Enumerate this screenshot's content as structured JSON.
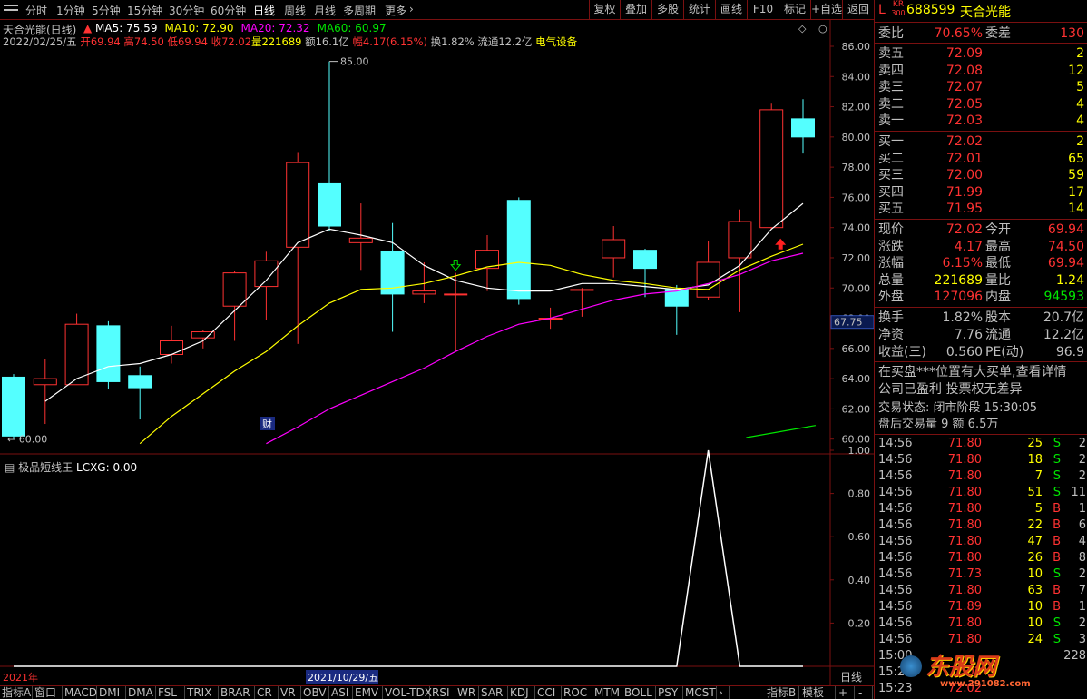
{
  "topbar": {
    "tabs": [
      "分时",
      "1分钟",
      "5分钟",
      "15分钟",
      "30分钟",
      "60分钟",
      "日线",
      "周线",
      "月线",
      "多周期",
      "更多"
    ],
    "active": "日线",
    "more_arrow": "›",
    "buttons": [
      "复权",
      "叠加",
      "多股",
      "统计",
      "画线",
      "F10",
      "标记",
      "+自选",
      "返回"
    ]
  },
  "chart": {
    "title": "天合光能(日线)",
    "ma": [
      {
        "label": "MA5: 75.59",
        "color": "#ffffff"
      },
      {
        "label": "MA10: 72.90",
        "color": "#ffff00"
      },
      {
        "label": "MA20: 72.32",
        "color": "#ff00ff"
      },
      {
        "label": "MA60: 60.97",
        "color": "#00e600"
      }
    ],
    "ohlc_line": {
      "date": "2022/02/25/五",
      "open": "开69.94",
      "high": "高74.50",
      "low": "低69.94",
      "close": "收72.02",
      "volume": "量221689",
      "amount": "额16.1亿",
      "change": "幅4.17(6.15%)",
      "turnover": "换1.82%",
      "float": "流通12.2亿",
      "sector": "电气设备"
    },
    "high_marker": "85.00",
    "low_marker": "60.00",
    "price_label": "67.75",
    "cai_badge": "财",
    "y_ticks": [
      "86.00",
      "84.00",
      "82.00",
      "80.00",
      "78.00",
      "76.00",
      "74.00",
      "72.00",
      "70.00",
      "68.00",
      "66.00",
      "64.00",
      "62.00",
      "60.00"
    ],
    "date_left": "2021年",
    "date_mid": "2021/10/29/五",
    "period_label": "日线"
  },
  "indicator": {
    "title": "极品短线王",
    "value": "LCXG: 0.00",
    "y_ticks": [
      "1.00",
      "0.80",
      "0.60",
      "0.40",
      "0.20"
    ]
  },
  "chart_data": {
    "type": "candlestick",
    "ylim": [
      59.5,
      86.6
    ],
    "candles": [
      {
        "o": 64.1,
        "h": 64.3,
        "l": 60.0,
        "c": 60.2
      },
      {
        "o": 63.6,
        "h": 65.3,
        "l": 61.0,
        "c": 64.0
      },
      {
        "o": 63.6,
        "h": 68.3,
        "l": 63.6,
        "c": 67.6
      },
      {
        "o": 67.5,
        "h": 67.8,
        "l": 63.3,
        "c": 63.8
      },
      {
        "o": 64.2,
        "h": 64.8,
        "l": 61.3,
        "c": 63.4
      },
      {
        "o": 65.6,
        "h": 67.5,
        "l": 65.0,
        "c": 66.5
      },
      {
        "o": 66.7,
        "h": 67.2,
        "l": 66.0,
        "c": 67.1
      },
      {
        "o": 68.8,
        "h": 71.1,
        "l": 66.5,
        "c": 71.0
      },
      {
        "o": 70.1,
        "h": 72.4,
        "l": 67.9,
        "c": 71.8
      },
      {
        "o": 72.7,
        "h": 79.0,
        "l": 66.3,
        "c": 78.3
      },
      {
        "o": 76.9,
        "h": 85.0,
        "l": 73.8,
        "c": 74.1
      },
      {
        "o": 73.0,
        "h": 75.6,
        "l": 71.2,
        "c": 73.3
      },
      {
        "o": 72.4,
        "h": 74.3,
        "l": 67.1,
        "c": 69.6
      },
      {
        "o": 69.6,
        "h": 71.7,
        "l": 69.0,
        "c": 69.8
      },
      {
        "o": 69.6,
        "h": 71.0,
        "l": 65.8,
        "c": 69.6
      },
      {
        "o": 71.3,
        "h": 73.5,
        "l": 69.8,
        "c": 72.5
      },
      {
        "o": 75.8,
        "h": 76.0,
        "l": 68.9,
        "c": 69.3
      },
      {
        "o": 68.0,
        "h": 68.7,
        "l": 67.3,
        "c": 68.0
      },
      {
        "o": 69.9,
        "h": 70.0,
        "l": 68.1,
        "c": 69.9
      },
      {
        "o": 72.0,
        "h": 74.1,
        "l": 70.7,
        "c": 73.2
      },
      {
        "o": 72.5,
        "h": 72.6,
        "l": 69.4,
        "c": 71.3
      },
      {
        "o": 69.9,
        "h": 70.2,
        "l": 66.9,
        "c": 68.8
      },
      {
        "o": 69.4,
        "h": 73.1,
        "l": 69.2,
        "c": 71.7
      },
      {
        "o": 72.0,
        "h": 75.2,
        "l": 68.4,
        "c": 74.4
      },
      {
        "o": 74.0,
        "h": 82.2,
        "l": 73.9,
        "c": 81.8
      },
      {
        "o": 81.2,
        "h": 82.5,
        "l": 78.9,
        "c": 80.0
      }
    ],
    "ma5": [
      null,
      62.5,
      64.0,
      64.8,
      65.0,
      65.6,
      66.5,
      68.5,
      70.5,
      73.0,
      73.9,
      73.5,
      73.0,
      71.5,
      70.5,
      70.0,
      69.8,
      69.8,
      70.3,
      70.3,
      70.1,
      69.9,
      70.2,
      71.5,
      73.9,
      75.6
    ],
    "ma10": [
      null,
      null,
      null,
      null,
      59.7,
      61.5,
      63.0,
      64.5,
      65.8,
      67.5,
      69.0,
      69.9,
      70.0,
      70.3,
      70.8,
      71.4,
      71.7,
      71.5,
      70.9,
      70.5,
      70.3,
      70.0,
      69.9,
      71.2,
      72.1,
      72.9
    ],
    "ma20": [
      null,
      null,
      null,
      null,
      null,
      null,
      null,
      null,
      59.7,
      60.8,
      62.0,
      62.9,
      63.8,
      64.7,
      65.8,
      66.8,
      67.6,
      68.0,
      68.6,
      69.2,
      69.6,
      69.8,
      70.3,
      70.9,
      71.8,
      72.3
    ],
    "ma60": [
      {
        "x": 23.2,
        "y": 60.1
      },
      {
        "x": 25.4,
        "y": 60.9
      }
    ],
    "lcxg": [
      0,
      0,
      0,
      0,
      0,
      0,
      0,
      0,
      0,
      0,
      0,
      0,
      0,
      0,
      0,
      0,
      0,
      0,
      0,
      0,
      0,
      0,
      1,
      0,
      0,
      0
    ],
    "up_arrow_index": 24,
    "down_arrow_index": 14
  },
  "quote": {
    "market_badge": "L",
    "kr_badge": "KR",
    "kr_sub": "300",
    "code": "688599",
    "name": "天合光能",
    "weibi_label": "委比",
    "weibi": "70.65%",
    "weicha_label": "委差",
    "weicha": "130",
    "asks": [
      {
        "label": "卖五",
        "price": "72.09",
        "vol": "2"
      },
      {
        "label": "卖四",
        "price": "72.08",
        "vol": "12"
      },
      {
        "label": "卖三",
        "price": "72.07",
        "vol": "5"
      },
      {
        "label": "卖二",
        "price": "72.05",
        "vol": "4"
      },
      {
        "label": "卖一",
        "price": "72.03",
        "vol": "4"
      }
    ],
    "bids": [
      {
        "label": "买一",
        "price": "72.02",
        "vol": "2"
      },
      {
        "label": "买二",
        "price": "72.01",
        "vol": "65"
      },
      {
        "label": "买三",
        "price": "72.00",
        "vol": "59"
      },
      {
        "label": "买四",
        "price": "71.99",
        "vol": "17"
      },
      {
        "label": "买五",
        "price": "71.95",
        "vol": "14"
      }
    ],
    "stats": [
      {
        "l1": "现价",
        "v1": "72.02",
        "c1": "#ff3232",
        "l2": "今开",
        "v2": "69.94",
        "c2": "#ff3232"
      },
      {
        "l1": "涨跌",
        "v1": "4.17",
        "c1": "#ff3232",
        "l2": "最高",
        "v2": "74.50",
        "c2": "#ff3232"
      },
      {
        "l1": "涨幅",
        "v1": "6.15%",
        "c1": "#ff3232",
        "l2": "最低",
        "v2": "69.94",
        "c2": "#ff3232"
      },
      {
        "l1": "总量",
        "v1": "221689",
        "c1": "#ffff00",
        "l2": "量比",
        "v2": "1.24",
        "c2": "#ffff00"
      },
      {
        "l1": "外盘",
        "v1": "127096",
        "c1": "#ff3232",
        "l2": "内盘",
        "v2": "94593",
        "c2": "#00e600"
      }
    ],
    "fin": [
      {
        "l1": "换手",
        "v1": "1.82%",
        "l2": "股本",
        "v2": "20.7亿"
      },
      {
        "l1": "净资",
        "v1": "7.76",
        "l2": "流通",
        "v2": "12.2亿"
      },
      {
        "l1": "收益(三)",
        "v1": "0.560",
        "l2": "PE(动)",
        "v2": "96.9"
      }
    ],
    "notes": [
      "在买盘***位置有大买单,查看详情",
      "公司已盈利 投票权无差异"
    ],
    "trade_status": "交易状态: 闭市阶段 15:30:05",
    "after_hours": "盘后交易量 9 额 6.5万"
  },
  "ticks": [
    {
      "t": "14:56",
      "p": "71.80",
      "v": "25",
      "s": "S",
      "n": "2"
    },
    {
      "t": "14:56",
      "p": "71.80",
      "v": "18",
      "s": "S",
      "n": "2"
    },
    {
      "t": "14:56",
      "p": "71.80",
      "v": "7",
      "s": "S",
      "n": "2"
    },
    {
      "t": "14:56",
      "p": "71.80",
      "v": "51",
      "s": "S",
      "n": "11"
    },
    {
      "t": "14:56",
      "p": "71.80",
      "v": "5",
      "s": "B",
      "n": "1"
    },
    {
      "t": "14:56",
      "p": "71.80",
      "v": "22",
      "s": "B",
      "n": "6"
    },
    {
      "t": "14:56",
      "p": "71.80",
      "v": "47",
      "s": "B",
      "n": "4"
    },
    {
      "t": "14:56",
      "p": "71.80",
      "v": "26",
      "s": "B",
      "n": "8"
    },
    {
      "t": "14:56",
      "p": "71.73",
      "v": "10",
      "s": "S",
      "n": "2"
    },
    {
      "t": "14:56",
      "p": "71.80",
      "v": "63",
      "s": "B",
      "n": "7"
    },
    {
      "t": "14:56",
      "p": "71.89",
      "v": "10",
      "s": "B",
      "n": "1"
    },
    {
      "t": "14:56",
      "p": "71.80",
      "v": "10",
      "s": "S",
      "n": "2"
    },
    {
      "t": "14:56",
      "p": "71.80",
      "v": "24",
      "s": "S",
      "n": "3"
    },
    {
      "t": "15:00",
      "p": "",
      "v": "",
      "s": "",
      "n": "228"
    },
    {
      "t": "15:23",
      "p": "72.02",
      "v": "",
      "s": "",
      "n": ""
    },
    {
      "t": "15:23",
      "p": "72.02",
      "v": "",
      "s": "",
      "n": ""
    }
  ],
  "bottom_tabs": [
    "指标A",
    "窗口",
    "MACD",
    "DMI",
    "DMA",
    "FSL",
    "TRIX",
    "BRAR",
    "CR",
    "VR",
    "OBV",
    "ASI",
    "EMV",
    "VOL-TDX",
    "RSI",
    "WR",
    "SAR",
    "KDJ",
    "CCI",
    "ROC",
    "MTM",
    "BOLL",
    "PSY",
    "MCST"
  ],
  "bottom_tabs_more": "›",
  "bottom_right": [
    "指标B",
    "模板",
    "+",
    "-"
  ],
  "watermark": {
    "brand": "东股网",
    "url": "www.291082.com"
  },
  "colors": {
    "up": "#ff3232",
    "down": "#54ffff",
    "ma5": "#ffffff",
    "ma10": "#ffff00",
    "ma20": "#ff00ff",
    "ma60": "#00e600",
    "grid": "#7a1010"
  }
}
